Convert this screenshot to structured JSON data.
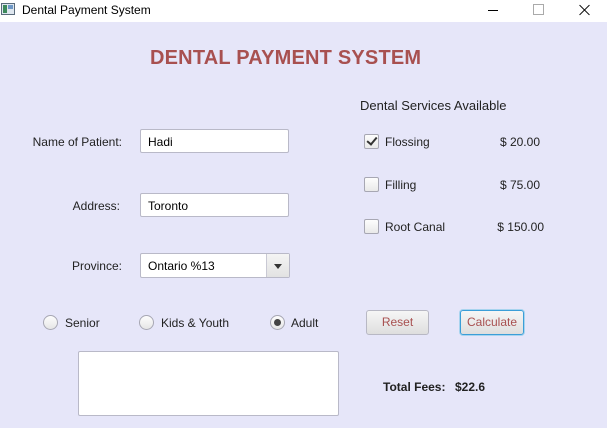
{
  "window": {
    "title": "Dental Payment System",
    "icons": {
      "app": "app-icon",
      "minimize": "minimize-icon",
      "maximize": "maximize-icon",
      "close": "close-icon"
    }
  },
  "header": {
    "title": "DENTAL PAYMENT SYSTEM"
  },
  "form": {
    "patient_label": "Name of Patient:",
    "patient_value": "Hadi",
    "address_label": "Address:",
    "address_value": "Toronto",
    "province_label": "Province:",
    "province_value": "Ontario %13"
  },
  "services": {
    "header": "Dental Services Available",
    "items": [
      {
        "label": "Flossing",
        "price": "$ 20.00",
        "checked": true
      },
      {
        "label": "Filling",
        "price": "$ 75.00",
        "checked": false
      },
      {
        "label": "Root Canal",
        "price": "$ 150.00",
        "checked": false
      }
    ]
  },
  "age_group": {
    "options": [
      {
        "label": "Senior",
        "selected": false
      },
      {
        "label": "Kids & Youth",
        "selected": false
      },
      {
        "label": "Adult",
        "selected": true
      }
    ]
  },
  "actions": {
    "reset_label": "Reset",
    "calculate_label": "Calculate"
  },
  "output": {
    "text": ""
  },
  "totals": {
    "label": "Total Fees:",
    "value": "$22.6"
  },
  "colors": {
    "background": "#e6e6f9",
    "title": "#a85050",
    "button_text": "#a85050",
    "focus": "#3b9ed8"
  }
}
